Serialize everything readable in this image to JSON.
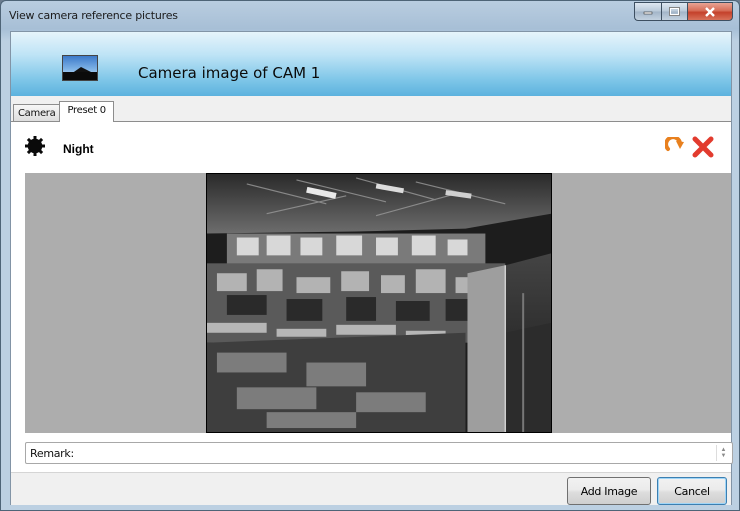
{
  "window": {
    "title": "View camera reference pictures"
  },
  "header": {
    "title": "Camera image of CAM  1",
    "icon": "landscape-picture-icon"
  },
  "tabs": [
    {
      "label": "Camera",
      "active": false
    },
    {
      "label": "Preset 0",
      "active": true
    }
  ],
  "preset": {
    "mode_label": "Night",
    "mode_icon": "night-gear-icon",
    "actions": [
      {
        "icon": "refresh-icon",
        "color": "#e8801e"
      },
      {
        "icon": "delete-icon",
        "color": "#e23b2e"
      }
    ]
  },
  "remark": {
    "label": "Remark:"
  },
  "buttons": {
    "add_image": "Add Image",
    "cancel": "Cancel"
  },
  "colors": {
    "header_gradient_end": "#5cb2de",
    "image_background": "#adadad"
  }
}
